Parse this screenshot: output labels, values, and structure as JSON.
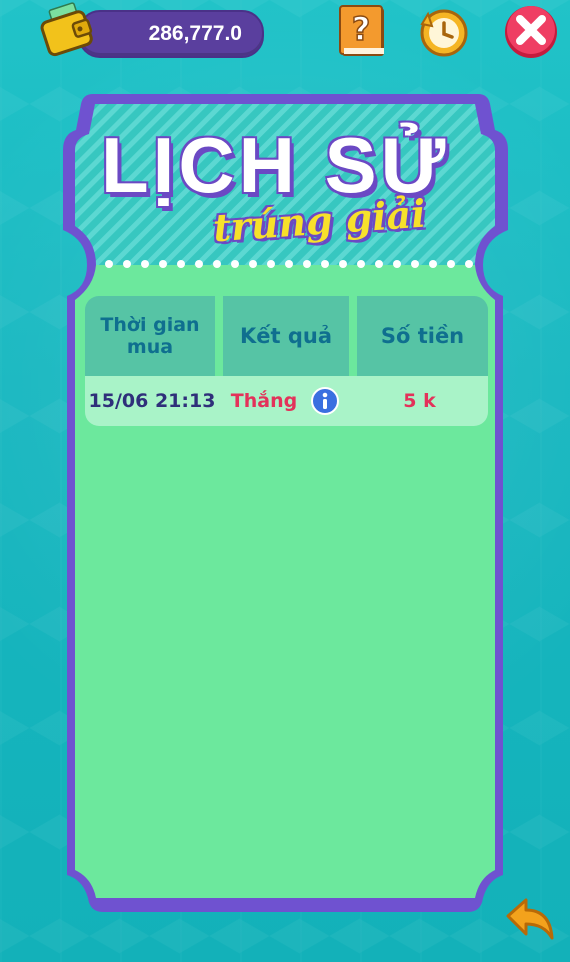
{
  "wallet": {
    "balance": "286,777.0"
  },
  "header": {
    "title_main": "LỊCH SỬ",
    "title_sub": "trúng giải"
  },
  "table": {
    "columns": [
      "Thời gian mua",
      "Kết quả",
      "Số tiền"
    ],
    "rows": [
      {
        "time": "15/06 21:13",
        "result": "Thắng",
        "amount": "5 k"
      }
    ]
  },
  "icons": {
    "wallet": "wallet-icon",
    "help": "question-book-icon",
    "history": "clock-history-icon",
    "close": "close-icon",
    "info": "info-icon",
    "back": "back-arrow-icon"
  },
  "colors": {
    "background": "#17b7c0",
    "card_fill": "#6ce89d",
    "card_border": "#6f52d0",
    "header_cell": "#56c4a5",
    "row_fill": "#a9f3c8",
    "accent_red": "#e3325a",
    "title_yellow": "#f7e12b"
  }
}
